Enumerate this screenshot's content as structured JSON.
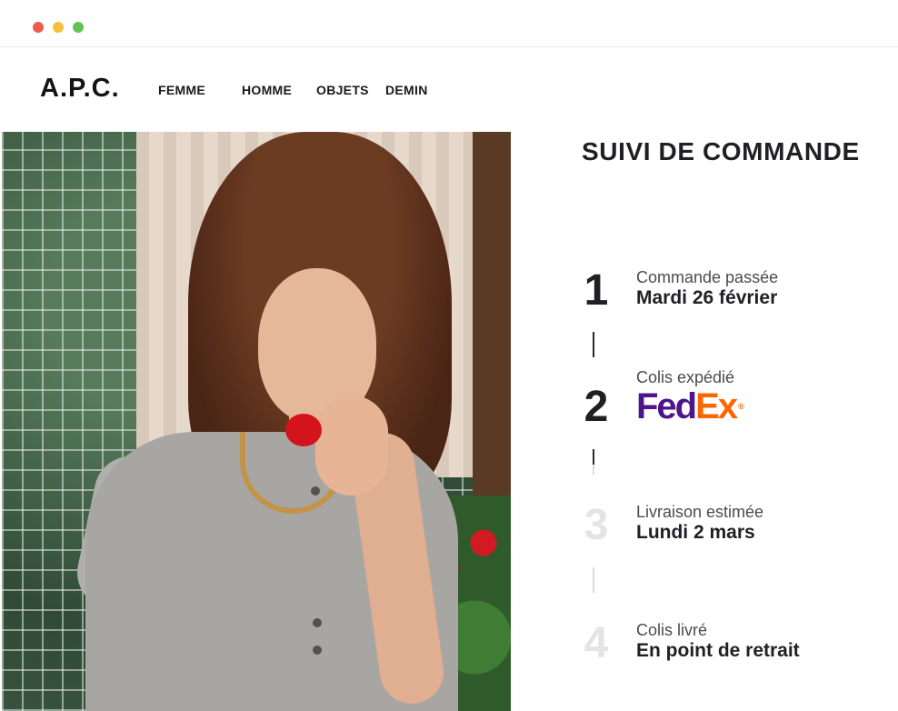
{
  "window": {
    "controls": [
      "close",
      "minimize",
      "maximize"
    ],
    "colors": {
      "close": "#ed5b4f",
      "minimize": "#f6be3b",
      "maximize": "#5fc454"
    }
  },
  "header": {
    "logo": "A.P.C.",
    "nav": {
      "femme": "FEMME",
      "homme": "HOMME",
      "objets": "OBJETS",
      "demin": "DEMIN"
    }
  },
  "tracking": {
    "title": "SUIVI DE COMMANDE",
    "steps": [
      {
        "number": "1",
        "label": "Commande passée",
        "value": "Mardi 26 février",
        "state": "done"
      },
      {
        "number": "2",
        "label": "Colis expédié",
        "carrier_logo": "FedEx",
        "carrier_parts": [
          "Fed",
          "Ex",
          "®"
        ],
        "state": "done"
      },
      {
        "number": "3",
        "label": "Livraison estimée",
        "value": "Lundi 2 mars",
        "state": "pending"
      },
      {
        "number": "4",
        "label": "Colis livré",
        "value": "En point de retrait",
        "state": "pending"
      }
    ],
    "colors": {
      "active_number": "#1f1f24",
      "inactive_number": "#e4e4e4",
      "fedex_purple": "#4d148c",
      "fedex_orange": "#ff6600"
    }
  }
}
